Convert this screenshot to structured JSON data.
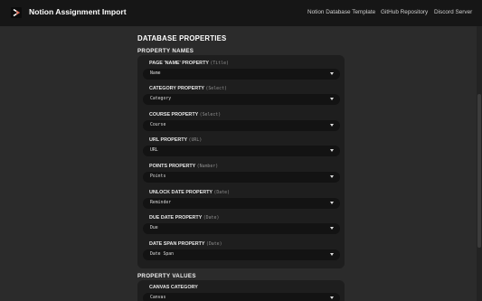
{
  "app": {
    "title": "Notion Assignment Import"
  },
  "nav": {
    "links": [
      "Notion Database Template",
      "GitHub Repository",
      "Discord Server"
    ]
  },
  "sections": {
    "database_properties": "DATABASE PROPERTIES",
    "property_names": "PROPERTY NAMES",
    "property_values": "PROPERTY VALUES"
  },
  "fields": [
    {
      "label": "PAGE 'NAME' PROPERTY",
      "type": "(Title)",
      "value": "Name"
    },
    {
      "label": "CATEGORY PROPERTY",
      "type": "(Select)",
      "value": "Category"
    },
    {
      "label": "COURSE PROPERTY",
      "type": "(Select)",
      "value": "Course"
    },
    {
      "label": "URL PROPERTY",
      "type": "(URL)",
      "value": "URL"
    },
    {
      "label": "POINTS PROPERTY",
      "type": "(Number)",
      "value": "Points"
    },
    {
      "label": "UNLOCK DATE PROPERTY",
      "type": "(Date)",
      "value": "Reminder"
    },
    {
      "label": "DUE DATE PROPERTY",
      "type": "(Date)",
      "value": "Due"
    },
    {
      "label": "DATE SPAN PROPERTY",
      "type": "(Date)",
      "value": "Date Span"
    }
  ],
  "values_fields": [
    {
      "label": "CANVAS CATEGORY",
      "value": "Canvas"
    }
  ]
}
